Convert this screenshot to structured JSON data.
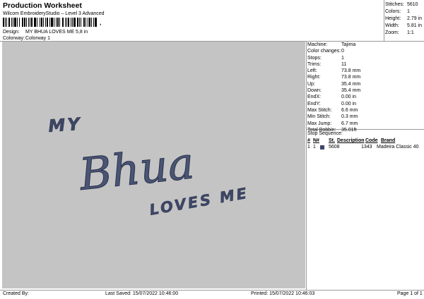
{
  "header": {
    "title": "Production Worksheet",
    "software": "Wilcom EmbroideryStudio – Level 3 Advanced",
    "barcode_trail": ",",
    "design_label": "Design:",
    "design_value": "MY BHUA LOVES ME 5,8 in",
    "colorway_label": "Colorway:",
    "colorway_value": "Colorway 1"
  },
  "summary": [
    {
      "label": "Stitches:",
      "value": "5610"
    },
    {
      "label": "Colors:",
      "value": "1"
    },
    {
      "label": "Height:",
      "value": "2.79 in"
    },
    {
      "label": "Width:",
      "value": "5.81 in"
    },
    {
      "label": "Zoom:",
      "value": "1:1"
    }
  ],
  "design": {
    "text_my": "MY",
    "text_bhua": "Bhua",
    "text_loves": "LOVES ME",
    "background_color": "#c4c4c4",
    "thread_color": "#3e4766"
  },
  "machine_info": [
    {
      "label": "Machine:",
      "value": "Tajima"
    },
    {
      "label": "Color changes:",
      "value": "0"
    },
    {
      "label": "Stops:",
      "value": "1"
    },
    {
      "label": "Trims:",
      "value": "11"
    },
    {
      "label": "Left:",
      "value": "73.8 mm"
    },
    {
      "label": "Right:",
      "value": "73.8 mm"
    },
    {
      "label": "Up:",
      "value": "35.4 mm"
    },
    {
      "label": "Down:",
      "value": "35.4 mm"
    },
    {
      "label": "EndX:",
      "value": "0.00 in"
    },
    {
      "label": "EndY:",
      "value": "0.00 in"
    },
    {
      "label": "Max Stitch:",
      "value": "6.6 mm"
    },
    {
      "label": "Min Stitch:",
      "value": "0.3 mm"
    },
    {
      "label": "Max Jump:",
      "value": "6.7 mm"
    },
    {
      "label": "Total Bobbin:",
      "value": "35.01ft"
    }
  ],
  "stop_sequence": {
    "title": "Stop Sequence:",
    "headers": [
      "#",
      "N#",
      "St.",
      "Description",
      "Code",
      "Brand"
    ],
    "rows": [
      {
        "num": "1",
        "n": "1",
        "swatch_color": "#3e4766",
        "st": "5608",
        "description": "",
        "code": "1343",
        "brand": "Madeira Classic 40"
      }
    ]
  },
  "footer": {
    "created_by": "Created By:",
    "last_saved": "Last Saved: 15/07/2022 10:46:00",
    "printed": "Printed: 15/07/2022 10:46:03",
    "page": "Page 1 of 1"
  }
}
